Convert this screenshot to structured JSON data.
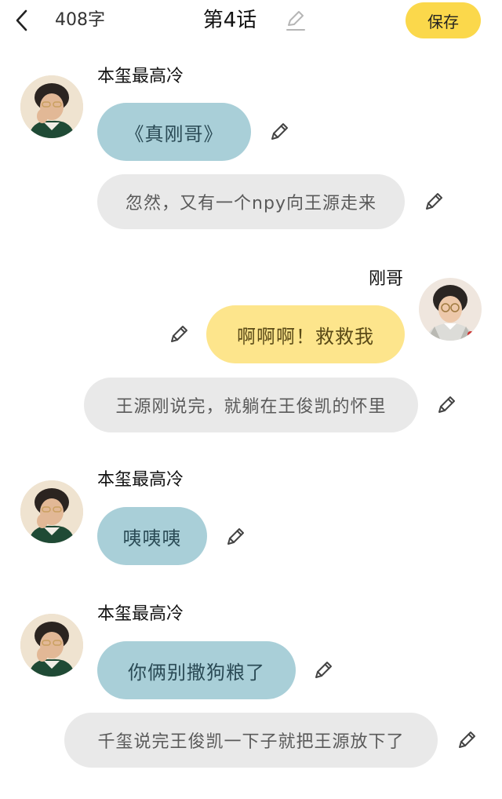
{
  "header": {
    "char_count": "408字",
    "title": "第4话",
    "save_label": "保存"
  },
  "messages": [
    {
      "speaker": "本玺最高冷",
      "text": "《真刚哥》",
      "style": "blue"
    },
    {
      "text": "忽然，又有一个npy向王源走来",
      "style": "narration"
    },
    {
      "speaker": "刚哥",
      "text": "啊啊啊！救救我",
      "style": "yellow"
    },
    {
      "text": "王源刚说完，就躺在王俊凯的怀里",
      "style": "narration"
    },
    {
      "speaker": "本玺最高冷",
      "text": "咦咦咦",
      "style": "blue"
    },
    {
      "speaker": "本玺最高冷",
      "text": "你俩别撒狗粮了",
      "style": "blue"
    },
    {
      "text": "千玺说完王俊凯一下子就把王源放下了",
      "style": "narration"
    }
  ],
  "colors": {
    "accent": "#fbd84b",
    "bubble_left": "#a9cfd8",
    "bubble_right": "#fde58c",
    "narration": "#e9e9e9"
  },
  "icons": {
    "back": "chevron-left-icon",
    "edit": "pencil-icon",
    "avatar": "avatar"
  }
}
